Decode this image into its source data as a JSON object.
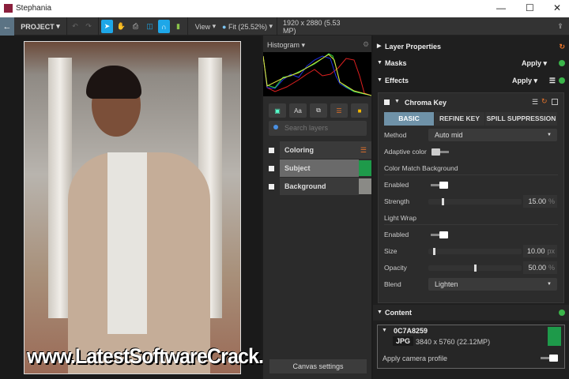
{
  "window": {
    "title": "Stephania"
  },
  "toolbar": {
    "project_label": "PROJECT",
    "view_label": "View",
    "zoom_label": "Fit (25.52%)",
    "image_info": "1920 x 2880 (5.53 MP)"
  },
  "canvas": {
    "watermark": "www.LatestSoftwareCrack.com"
  },
  "histogram": {
    "label": "Histogram"
  },
  "layers": {
    "search_placeholder": "Search layers",
    "items": [
      {
        "label": "Coloring"
      },
      {
        "label": "Subject",
        "selected": true
      },
      {
        "label": "Background"
      }
    ],
    "canvas_settings": "Canvas settings"
  },
  "right": {
    "layer_properties": "Layer Properties",
    "masks": {
      "label": "Masks",
      "apply": "Apply"
    },
    "effects": {
      "label": "Effects",
      "apply": "Apply"
    },
    "chroma": {
      "title": "Chroma Key",
      "tabs": [
        "BASIC",
        "REFINE KEY",
        "SPILL SUPPRESSION"
      ],
      "active_tab": "BASIC",
      "method_label": "Method",
      "method_value": "Auto mid",
      "adaptive_label": "Adaptive color",
      "adaptive_on": false,
      "cmb_label": "Color Match Background",
      "cmb_enabled_label": "Enabled",
      "cmb_enabled": true,
      "strength_label": "Strength",
      "strength_value": "15.00",
      "strength_unit": "%",
      "strength_fraction": 0.15,
      "lw_label": "Light Wrap",
      "lw_enabled_label": "Enabled",
      "lw_enabled": true,
      "size_label": "Size",
      "size_value": "10.00",
      "size_unit": "px",
      "size_fraction": 0.05,
      "opacity_label": "Opacity",
      "opacity_value": "50.00",
      "opacity_unit": "%",
      "opacity_fraction": 0.5,
      "blend_label": "Blend",
      "blend_value": "Lighten"
    },
    "content": {
      "label": "Content",
      "file": "0C7A8259",
      "format": "JPG",
      "dims": "3840 x 5760 (22.12MP)",
      "camera_profile_label": "Apply camera profile",
      "camera_profile_on": true
    }
  },
  "colors": {
    "accent": "#1ea7e8",
    "tab_active": "#6f92a8",
    "add": "#3bb54a",
    "reset": "#e8742a"
  }
}
